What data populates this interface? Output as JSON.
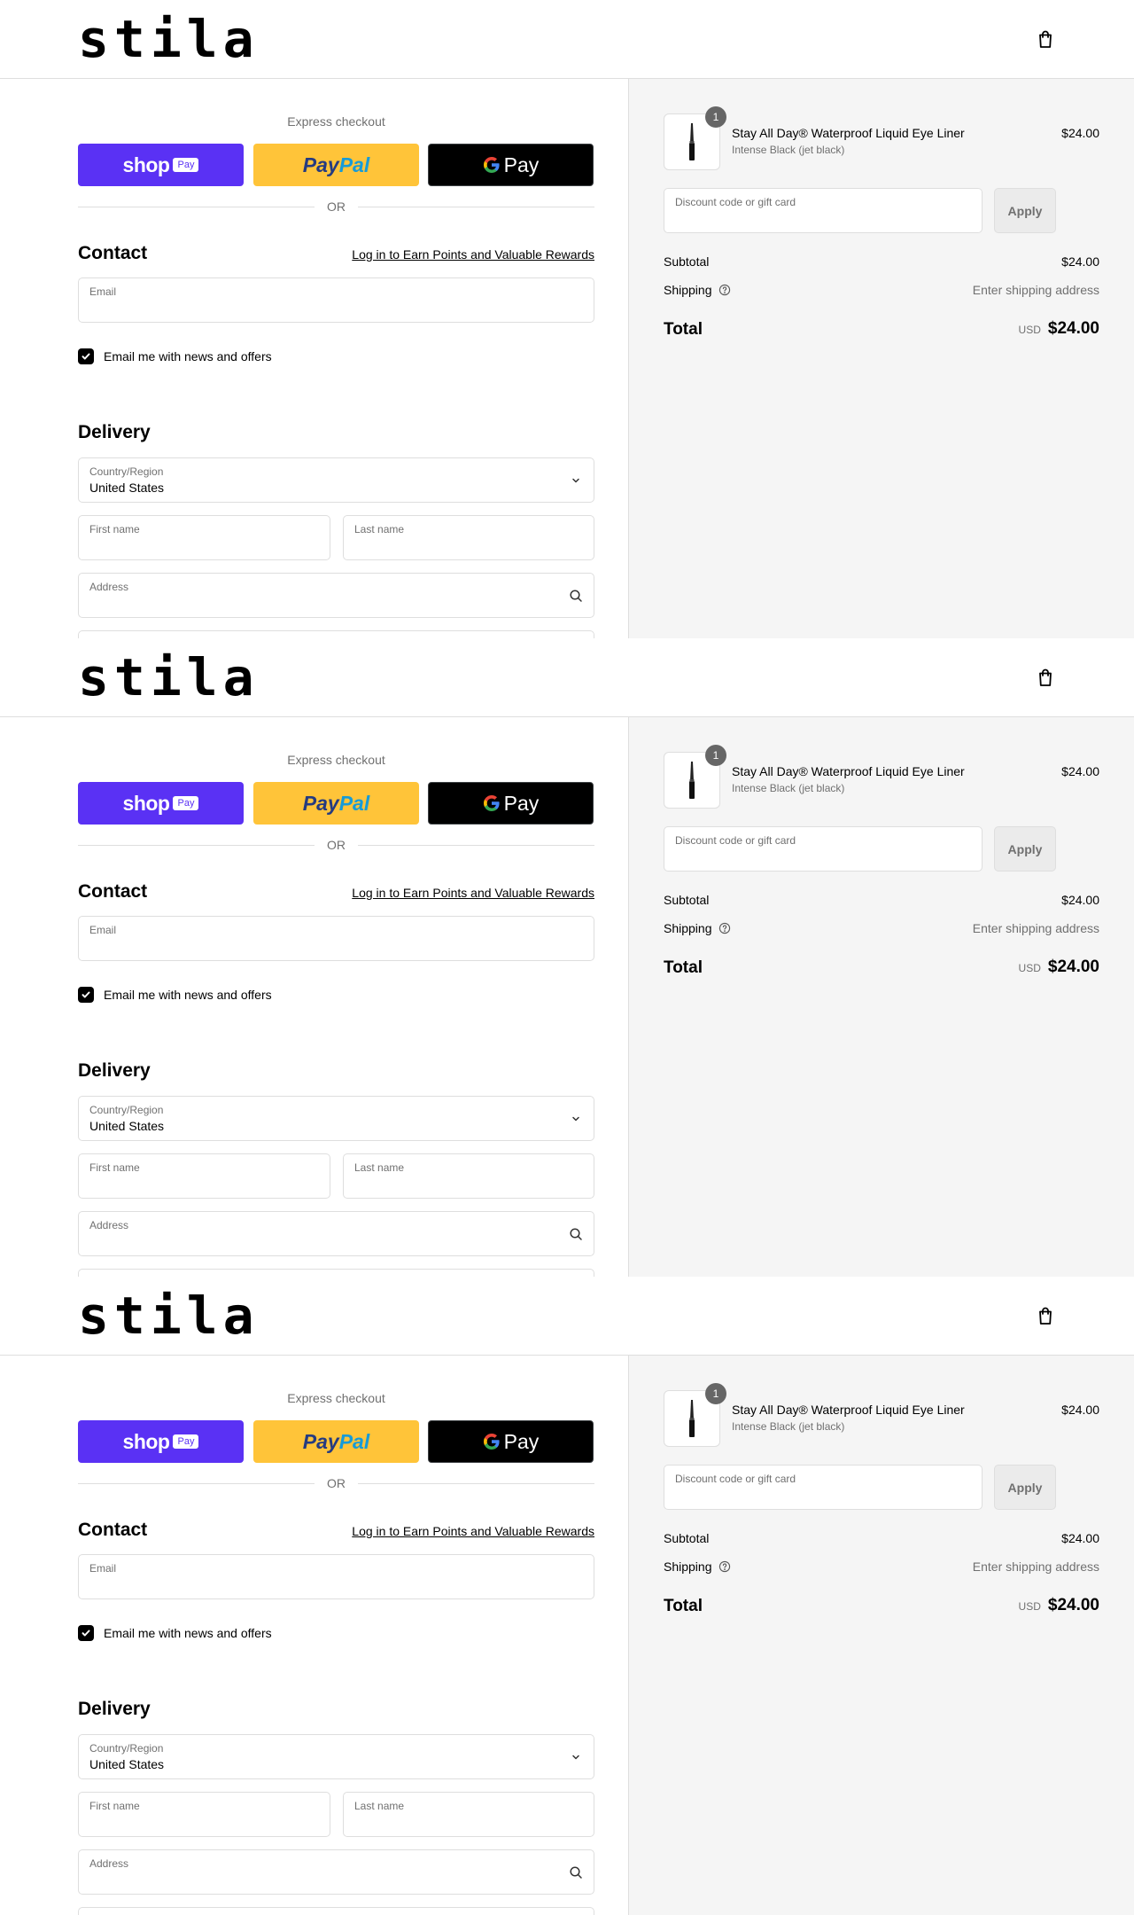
{
  "brand": {
    "logo_text": "stila"
  },
  "express": {
    "title": "Express checkout",
    "shop_pay": {
      "word": "shop",
      "tag": "Pay"
    },
    "paypal": {
      "pay": "Pay",
      "pal": "Pal"
    },
    "google_pay": {
      "g": "G",
      "word": "Pay"
    },
    "or_text": "OR"
  },
  "contact": {
    "heading": "Contact",
    "login_link": "Log in to Earn Points and Valuable Rewards",
    "email_label": "Email",
    "newsletter_label": "Email me with news and offers",
    "newsletter_checked": true
  },
  "delivery": {
    "heading": "Delivery",
    "country_label": "Country/Region",
    "country_value": "United States",
    "first_name_label": "First name",
    "last_name_label": "Last name",
    "address_label": "Address"
  },
  "summary": {
    "item": {
      "quantity": "1",
      "name": "Stay All Day® Waterproof Liquid Eye Liner",
      "variant": "Intense Black (jet black)",
      "price": "$24.00"
    },
    "discount_label": "Discount code or gift card",
    "apply_label": "Apply",
    "subtotal_label": "Subtotal",
    "subtotal_value": "$24.00",
    "shipping_label": "Shipping",
    "shipping_value": "Enter shipping address",
    "total_label": "Total",
    "currency": "USD",
    "total_value": "$24.00"
  },
  "colors": {
    "shop_pay": "#5a31f4",
    "paypal": "#ffc439",
    "google_pay": "#000000",
    "summary_bg": "#f5f5f5"
  },
  "icons": [
    "shopping-bag-icon",
    "chevron-down-icon",
    "search-icon",
    "checkmark-icon",
    "help-circle-icon",
    "eyeliner-product-image"
  ]
}
